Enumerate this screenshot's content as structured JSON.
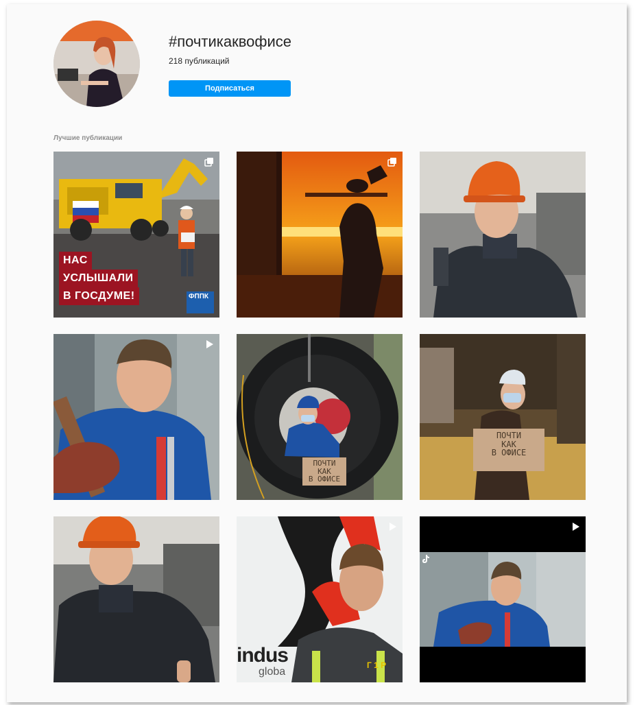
{
  "header": {
    "hashtag": "#почтикаквофисе",
    "posts_count": "218 публикаций",
    "follow_label": "Подписаться"
  },
  "section": {
    "title": "Лучшие публикации"
  },
  "posts": [
    {
      "banner_lines": [
        "НАС",
        "УСЛЫШАЛИ",
        "В ГОСДУМЕ!"
      ],
      "logo": "ФППК",
      "badge_icon": "carousel-icon"
    },
    {
      "badge_icon": "carousel-icon"
    },
    {},
    {
      "badge_icon": "video-play-icon"
    },
    {
      "sign_lines": [
        "ПОЧТИ",
        "КАК",
        "В ОФИСЕ"
      ]
    },
    {
      "sign_lines": [
        "ПОЧТИ",
        "КАК",
        "В ОФИСЕ"
      ]
    },
    {},
    {
      "logo": "indus",
      "logo_sub": "globa",
      "jacket_text": "Г 1 Р",
      "badge_icon": "video-play-icon"
    },
    {
      "badge_icon": "video-play-icon"
    }
  ],
  "colors": {
    "follow_button": "#0095f6",
    "page_background": "#fafafa",
    "muted_text": "#8e8e8e",
    "banner_red": "#9c1422"
  }
}
